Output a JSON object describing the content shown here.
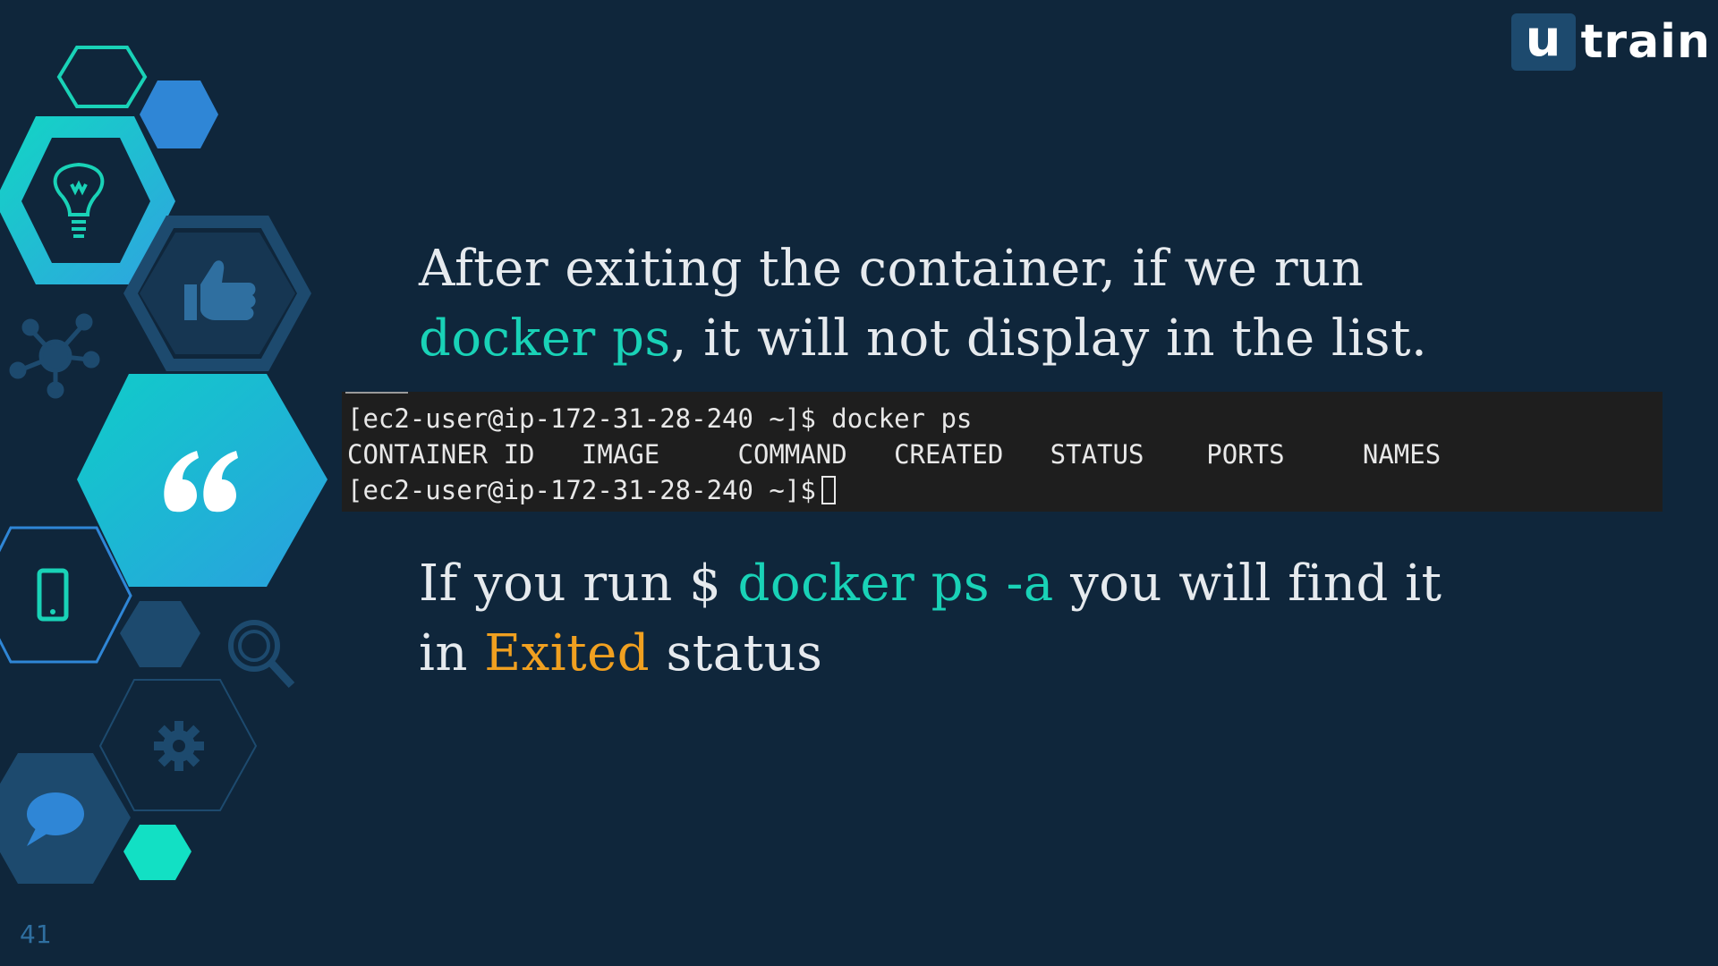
{
  "logo": {
    "mark": "u",
    "text": "train"
  },
  "headline": {
    "line1": "After exiting the container, if we run",
    "cmd": "docker ps",
    "line2_rest": ", it will not display in the list."
  },
  "terminal": {
    "prompt1": "[ec2-user@ip-172-31-28-240 ~]$ docker ps",
    "header": "CONTAINER ID   IMAGE     COMMAND   CREATED   STATUS    PORTS     NAMES",
    "prompt2": "[ec2-user@ip-172-31-28-240 ~]$"
  },
  "note": {
    "prefix": "If you run $ ",
    "cmd": "docker ps -a",
    "mid": " you will find it",
    "line2_prefix": "in ",
    "status_word": "Exited",
    "line2_suffix": " status"
  },
  "page_number": "41",
  "icons": [
    "lightbulb-icon",
    "thumbs-up-icon",
    "network-icon",
    "quote-icon",
    "smartphone-icon",
    "magnifier-icon",
    "gear-icon",
    "chat-bubble-icon"
  ],
  "colors": {
    "background": "#0f263b",
    "accent_teal": "#19d2b7",
    "accent_orange": "#f0a020",
    "terminal_bg": "#1e1e1e"
  }
}
